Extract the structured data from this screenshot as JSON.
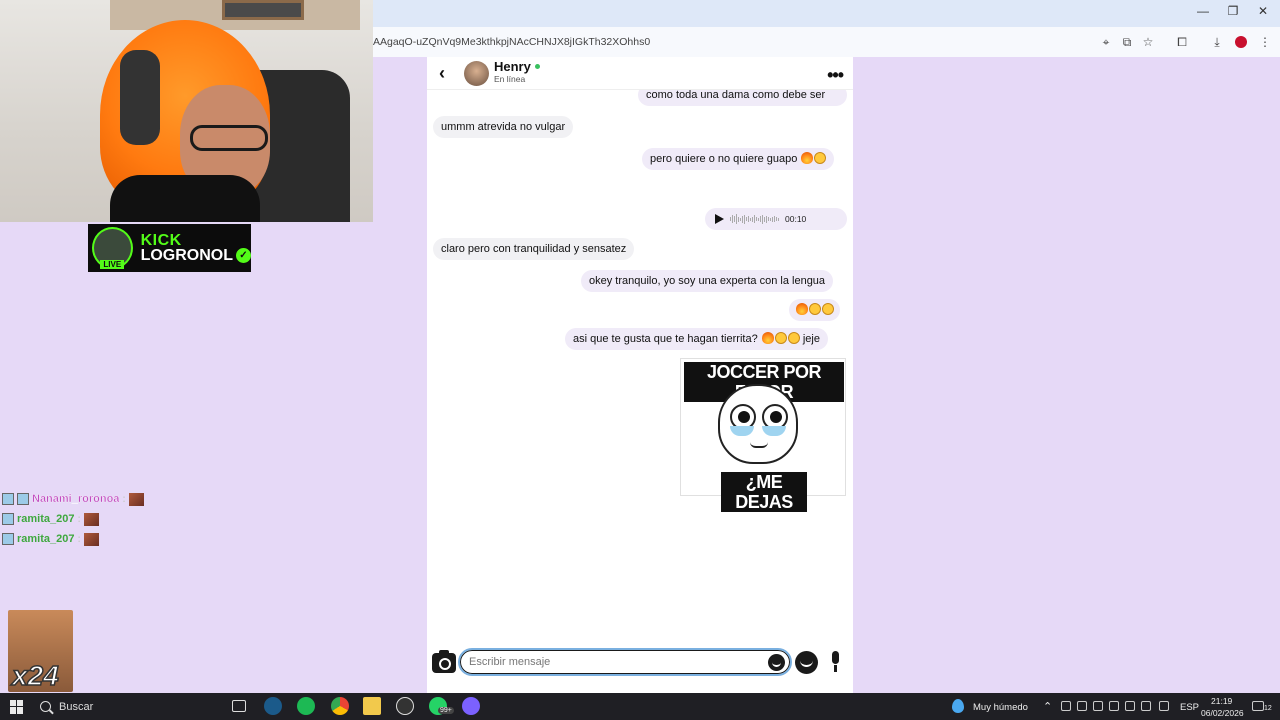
{
  "stream": {
    "kick_brand": "KICK",
    "kick_name": "LOGRONOL",
    "kick_live": "LIVE",
    "chat": [
      {
        "user": "Nanami_roronoa",
        "sep": ":"
      },
      {
        "user": "ramita_207",
        "sep": ":"
      },
      {
        "user": "ramita_207",
        "sep": ":"
      }
    ],
    "emote_count": "x24"
  },
  "browser": {
    "url": "AAgaqO-uZQnVq9Me3kthkpjNAcCHNJX8jIGkTh32XOhhs0",
    "controls": {
      "minimize": "—",
      "restore": "❐",
      "close": "✕"
    }
  },
  "chat_header": {
    "contact_name": "Henry",
    "status": "En línea"
  },
  "messages": [
    {
      "dir": "out",
      "text": "como toda una dama como debe ser",
      "emojis": []
    },
    {
      "dir": "in",
      "text": "ummm atrevida no vulgar",
      "emojis": []
    },
    {
      "dir": "out",
      "text": "pero quiere o no quiere guapo",
      "emojis": [
        "fire-emoji",
        "tongue-emoji"
      ]
    },
    {
      "dir": "out",
      "type": "voice",
      "duration": "00:10"
    },
    {
      "dir": "in",
      "text": "claro pero con tranquilidad y sensatez",
      "emojis": []
    },
    {
      "dir": "out",
      "text": "okey tranquilo, yo soy una experta con la lengua",
      "emojis": []
    },
    {
      "dir": "out",
      "text": "",
      "emojis": [
        "fire-emoji",
        "tongue-emoji",
        "tongue-emoji"
      ]
    },
    {
      "dir": "out",
      "text": "asi que te gusta que te hagan tierrita?",
      "suffix": "jeje",
      "emojis": [
        "fire-emoji",
        "tongue-emoji",
        "tongue-emoji"
      ]
    }
  ],
  "meme": {
    "top_text": "JOCCER POR FAVOR",
    "bottom_text": "¿ME DEJAS"
  },
  "composer": {
    "placeholder": "Escribir mensaje"
  },
  "taskbar": {
    "search_label": "Buscar",
    "weather": "Muy húmedo",
    "language": "ESP",
    "time": "21:19",
    "date": "06/02/2026",
    "whatsapp_badge": "99+",
    "notif_count": "12"
  },
  "colors": {
    "page_bg": "#e6d9f7",
    "outgoing_bubble": "#f0ebf8",
    "incoming_bubble": "#f1f1f4",
    "kick_green": "#53fc18",
    "online": "#39c05f",
    "taskbar": "#1f1f24"
  }
}
